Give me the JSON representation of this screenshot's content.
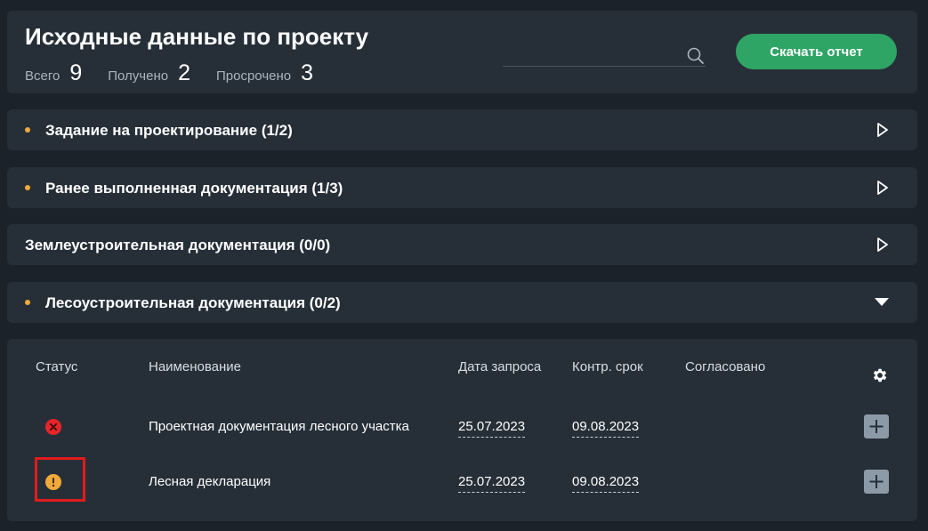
{
  "header": {
    "title": "Исходные данные по проекту",
    "stats": [
      {
        "label": "Всего",
        "value": "9"
      },
      {
        "label": "Получено",
        "value": "2"
      },
      {
        "label": "Просрочено",
        "value": "3"
      }
    ],
    "search_placeholder": "",
    "download_label": "Скачать отчет"
  },
  "sections": [
    {
      "label": "Задание на проектирование (1/2)",
      "has_dot": true,
      "expanded": false
    },
    {
      "label": "Ранее выполненная документация (1/3)",
      "has_dot": true,
      "expanded": false
    },
    {
      "label": "Землеустроительная документация (0/0)",
      "has_dot": false,
      "expanded": false
    },
    {
      "label": "Лесоустроительная документация (0/2)",
      "has_dot": true,
      "expanded": true
    }
  ],
  "table": {
    "headers": {
      "status": "Статус",
      "name": "Наименование",
      "request_date": "Дата запроса",
      "deadline": "Контр. срок",
      "approved": "Согласовано"
    },
    "rows": [
      {
        "status": "error",
        "name": "Проектная документация лесного участка",
        "request_date": "25.07.2023",
        "deadline": "09.08.2023",
        "approved": ""
      },
      {
        "status": "warning",
        "name": "Лесная декларация",
        "request_date": "25.07.2023",
        "deadline": "09.08.2023",
        "approved": ""
      }
    ]
  },
  "colors": {
    "background": "#1b2229",
    "panel": "#262f38",
    "accent_green": "#2ea564",
    "dot_orange": "#f2a93b",
    "status_error": "#e5252a",
    "status_warning": "#f2a93b",
    "highlight_red": "#e31b1b"
  },
  "icons": {
    "search": "search-icon",
    "collapsed": "play-outline-icon",
    "expanded": "triangle-down-icon",
    "settings": "gear-icon",
    "add": "plus-icon",
    "error": "x-circle-icon",
    "warning": "exclamation-circle-icon"
  }
}
